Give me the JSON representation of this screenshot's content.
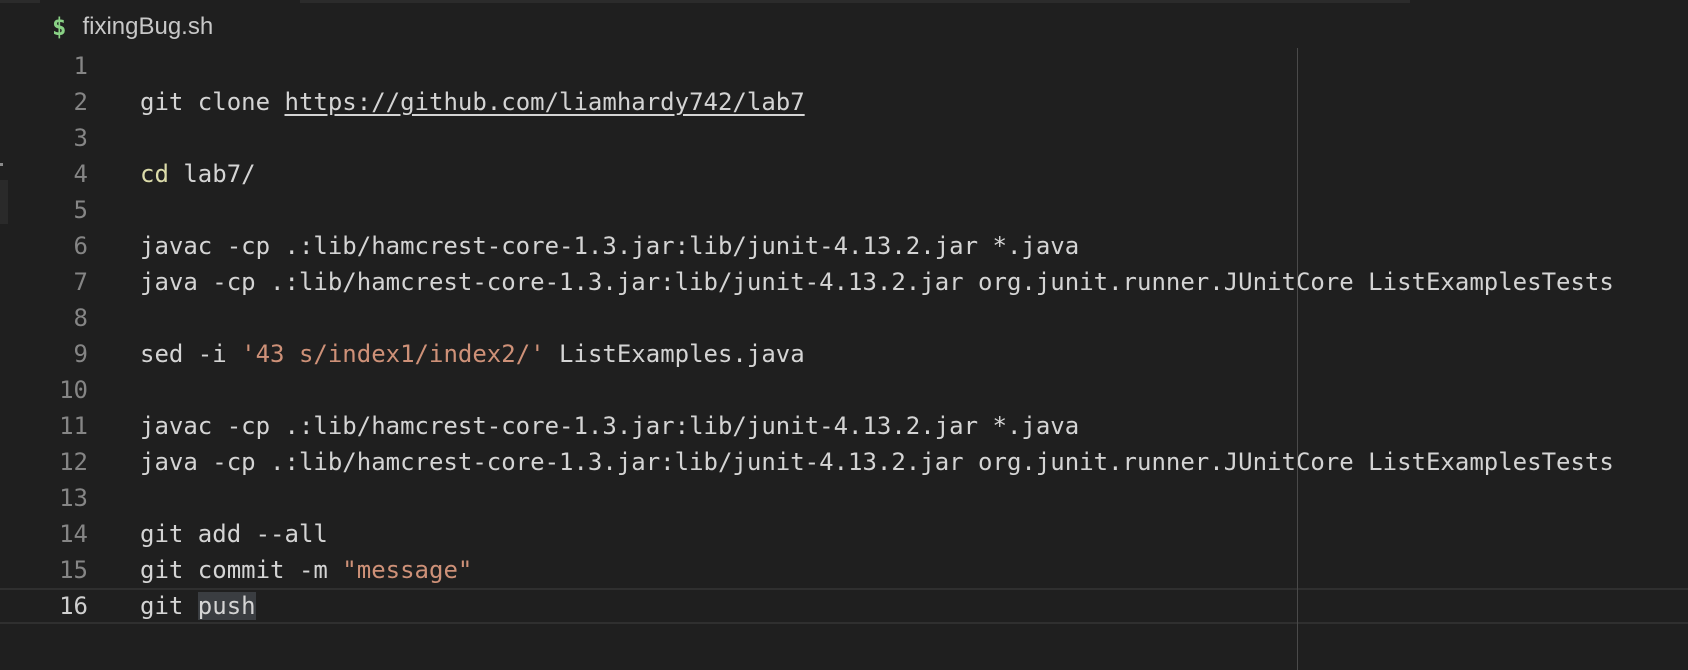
{
  "breadcrumb": {
    "icon": "$",
    "icon_name": "shell-script-icon",
    "filename": "fixingBug.sh"
  },
  "editor": {
    "current_line": 16,
    "lines": [
      {
        "number": "1",
        "text": ""
      },
      {
        "number": "2",
        "text": "git clone ",
        "url": "https://github.com/liamhardy742/lab7"
      },
      {
        "number": "3",
        "text": ""
      },
      {
        "number": "4",
        "keyword": "cd",
        "text": " lab7/"
      },
      {
        "number": "5",
        "text": ""
      },
      {
        "number": "6",
        "text": "javac -cp .:lib/hamcrest-core-1.3.jar:lib/junit-4.13.2.jar *.java"
      },
      {
        "number": "7",
        "text": "java -cp .:lib/hamcrest-core-1.3.jar:lib/junit-4.13.2.jar org.junit.runner.JUnitCore ListExamplesTests"
      },
      {
        "number": "8",
        "text": ""
      },
      {
        "number": "9",
        "text": "sed -i ",
        "string": "'43 s/index1/index2/'",
        "text_after": " ListExamples.java"
      },
      {
        "number": "10",
        "text": ""
      },
      {
        "number": "11",
        "text": "javac -cp .:lib/hamcrest-core-1.3.jar:lib/junit-4.13.2.jar *.java"
      },
      {
        "number": "12",
        "text": "java -cp .:lib/hamcrest-core-1.3.jar:lib/junit-4.13.2.jar org.junit.runner.JUnitCore ListExamplesTests"
      },
      {
        "number": "13",
        "text": ""
      },
      {
        "number": "14",
        "text": "git add --all"
      },
      {
        "number": "15",
        "text": "git commit -m ",
        "string": "\"message\""
      },
      {
        "number": "16",
        "text": "git ",
        "selected": "push"
      }
    ]
  },
  "colors": {
    "background": "#1f1f1f",
    "string": "#ce9178",
    "builtin": "#dcdcaa",
    "line_number": "#858585",
    "shell_icon": "#89d185"
  }
}
